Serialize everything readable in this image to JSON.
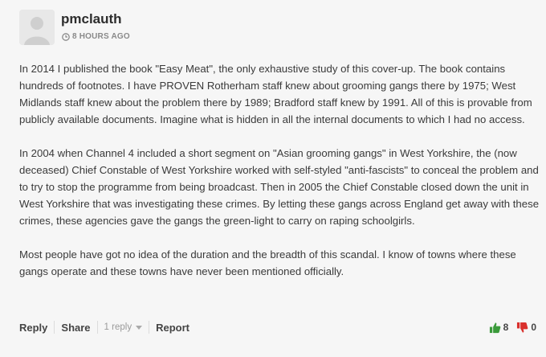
{
  "comment": {
    "username": "pmclauth",
    "timestamp": "8 HOURS AGO",
    "paragraphs": [
      "In 2014 I published the book \"Easy Meat\", the only exhaustive study of this cover-up.  The book contains hundreds of footnotes. I have PROVEN Rotherham staff knew about grooming gangs there by 1975;  West Midlands staff knew about the problem there by 1989; Bradford staff knew by 1991.  All of this is provable from publicly available documents.  Imagine what is hidden in all the internal documents to which I had no access.",
      "In 2004 when Channel 4 included a short segment on \"Asian grooming gangs\" in West Yorkshire, the (now deceased) Chief Constable of West Yorkshire worked with self-styled \"anti-fascists\" to conceal the problem and to try to stop the programme from being broadcast. Then in 2005 the Chief Constable closed down the unit in West Yorkshire that was investigating these crimes. By letting these gangs across England get away with these crimes, these agencies gave the gangs the green-light to carry on raping schoolgirls.",
      "Most people have got no idea of the duration and the breadth of this scandal. I know of towns where these gangs operate and these towns have never been mentioned officially."
    ]
  },
  "actions": {
    "reply_label": "Reply",
    "share_label": "Share",
    "replies_label": "1 reply",
    "report_label": "Report"
  },
  "votes": {
    "up_count": "8",
    "down_count": "0",
    "up_color": "#3a9a3a",
    "down_color": "#d9302c"
  },
  "icons": {
    "avatar": "default-user-avatar",
    "clock": "clock-icon",
    "caret": "caret-down-icon",
    "thumbs_up": "thumbs-up-icon",
    "thumbs_down": "thumbs-down-icon"
  }
}
